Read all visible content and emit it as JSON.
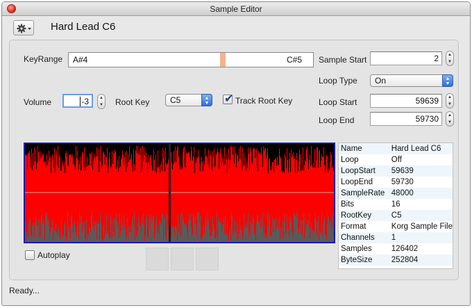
{
  "window": {
    "title": "Sample Editor"
  },
  "header": {
    "doc_title": "Hard Lead C6",
    "gear_icon": "gear-icon"
  },
  "keyrange": {
    "label": "KeyRange",
    "low": "A#4",
    "high": "C#5"
  },
  "volume": {
    "label": "Volume",
    "value": "-3"
  },
  "root_key": {
    "label": "Root Key",
    "value": "C5"
  },
  "track_root_key": {
    "label": "Track Root Key",
    "checked": true
  },
  "sample_start": {
    "label": "Sample Start",
    "value": "2"
  },
  "loop_type": {
    "label": "Loop Type",
    "value": "On"
  },
  "loop_start": {
    "label": "Loop Start",
    "value": "59639"
  },
  "loop_end": {
    "label": "Loop End",
    "value": "59730"
  },
  "autoplay": {
    "label": "Autoplay",
    "checked": false
  },
  "info": [
    {
      "key": "Name",
      "value": "Hard Lead C6"
    },
    {
      "key": "Loop",
      "value": "Off"
    },
    {
      "key": "LoopStart",
      "value": "59639"
    },
    {
      "key": "LoopEnd",
      "value": "59730"
    },
    {
      "key": "SampleRate",
      "value": "48000"
    },
    {
      "key": "Bits",
      "value": "16"
    },
    {
      "key": "RootKey",
      "value": "C5"
    },
    {
      "key": "Format",
      "value": "Korg Sample File"
    },
    {
      "key": "Channels",
      "value": "1"
    },
    {
      "key": "Samples",
      "value": "126402"
    },
    {
      "key": "ByteSize",
      "value": "252804"
    }
  ],
  "status": {
    "text": "Ready..."
  },
  "colors": {
    "waveform": "#ff0000",
    "waveform_bg": "#000000",
    "waveform_lower": "#5a5a5a",
    "waveform_border": "#1b1bb4",
    "key_marker": "#f2b48e"
  }
}
